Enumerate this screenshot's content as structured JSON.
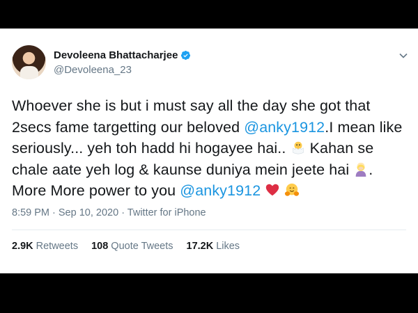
{
  "author": {
    "display_name": "Devoleena Bhattacharjee",
    "handle": "@Devoleena_23",
    "avatar_icon": "avatar-photo",
    "verified_icon": "verified-badge-icon"
  },
  "tweet": {
    "segments": {
      "t1": "Whoever she is but i must say all the day she got that 2secs fame targetting our beloved ",
      "m1": "@anky1912",
      "t2": ".I mean like seriously... yeh toh hadd hi hogayee hai.. ",
      "t3": " Kahan se chale aate yeh log & kaunse duniya mein jeete hai ",
      "t4": ". More More power to you ",
      "m2": "@anky1912",
      "t5": " "
    },
    "emojis": [
      "hatching-chick-icon",
      "woman-facepalming-icon",
      "red-heart-icon",
      "hugging-face-icon"
    ]
  },
  "meta": {
    "time": "8:59 PM",
    "sep1": " · ",
    "date": "Sep 10, 2020",
    "sep2": " · ",
    "source": "Twitter for iPhone"
  },
  "stats": {
    "retweets_count": "2.9K",
    "retweets_label": "Retweets",
    "quote_count": "108",
    "quote_label": "Quote Tweets",
    "likes_count": "17.2K",
    "likes_label": "Likes"
  },
  "colors": {
    "mention": "#1b95e0",
    "text": "#14171a",
    "secondary": "#657786",
    "background": "#000000",
    "card": "#ffffff"
  }
}
